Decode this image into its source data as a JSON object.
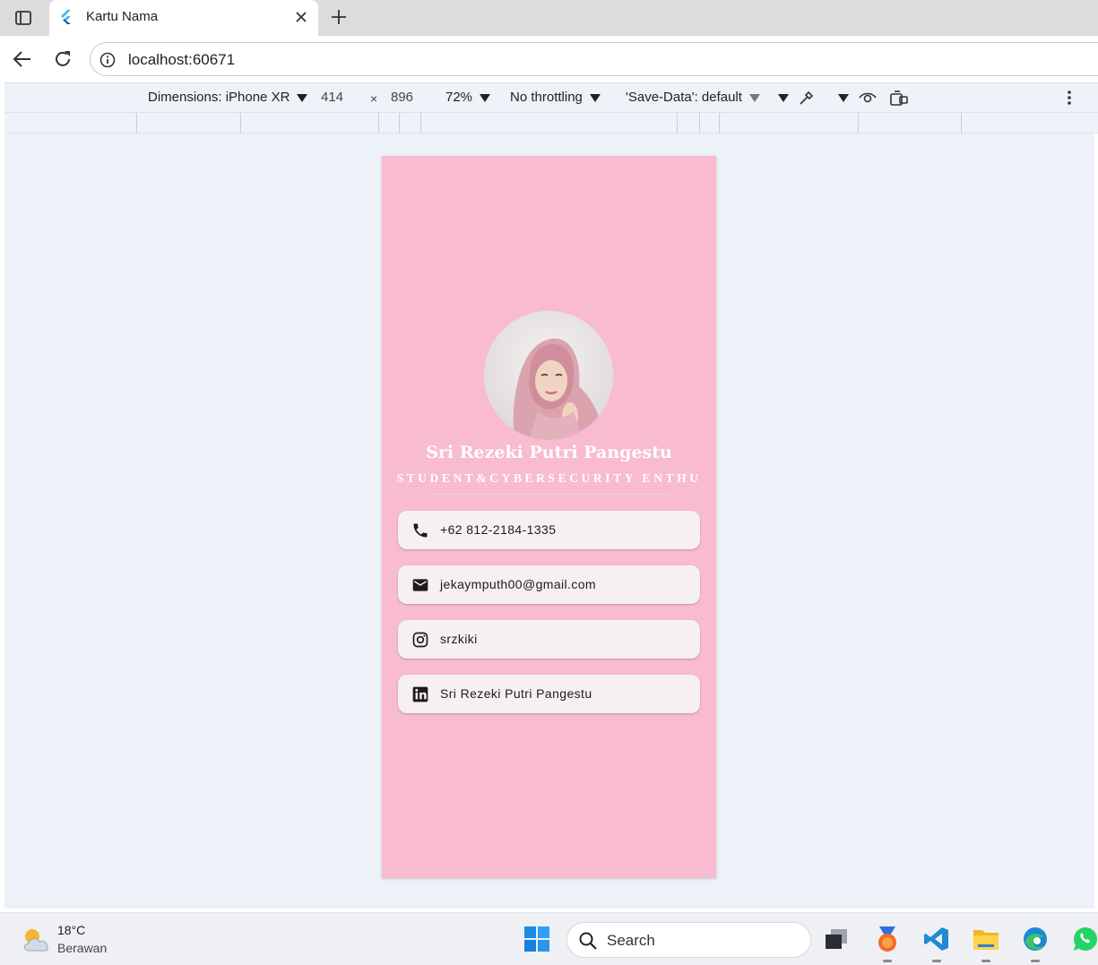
{
  "browser": {
    "tab_title": "Kartu Nama",
    "url": "localhost:60671"
  },
  "devtools": {
    "dimensions_label": "Dimensions: iPhone XR",
    "width": "414",
    "times": "×",
    "height": "896",
    "zoom": "72%",
    "throttling": "No throttling",
    "save_data": "'Save-Data': default"
  },
  "card": {
    "name": "Sri Rezeki Putri Pangestu",
    "tagline": "STUDENT&CYBERSECURITY ENTHU",
    "background": "#f8bbd0",
    "contacts": [
      {
        "icon": "phone-icon",
        "text": "+62 812-2184-1335"
      },
      {
        "icon": "email-icon",
        "text": "jekaymputh00@gmail.com"
      },
      {
        "icon": "instagram-icon",
        "text": "srzkiki"
      },
      {
        "icon": "linkedin-icon",
        "text": "Sri Rezeki Putri Pangestu"
      }
    ]
  },
  "taskbar": {
    "temperature": "18°C",
    "weather": "Berawan",
    "search_label": "Search"
  }
}
